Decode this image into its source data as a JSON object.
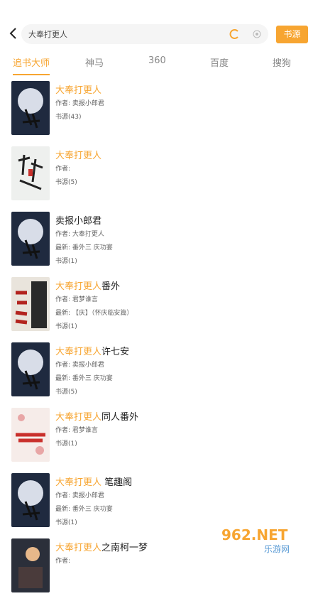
{
  "search": {
    "query": "大奉打更人",
    "button": "书源"
  },
  "tabs": [
    "追书大师",
    "神马",
    "360",
    "百度",
    "搜狗"
  ],
  "books": [
    {
      "hl": "大奉打更人",
      "rest": "",
      "author": "作者: 卖报小郎君",
      "latest": "",
      "sources": "书源(43)"
    },
    {
      "hl": "大奉打更人",
      "rest": "",
      "author": "作者:",
      "latest": "",
      "sources": "书源(5)"
    },
    {
      "hl": "",
      "rest": "卖报小郎君",
      "author": "作者: 大奉打更人",
      "latest": "最新: 番外三 庆功宴",
      "sources": "书源(1)"
    },
    {
      "hl": "大奉打更人",
      "rest": "番外",
      "author": "作者: 君梦谁言",
      "latest": "最新: 【庆】（怀庆临安篇）",
      "sources": "书源(1)"
    },
    {
      "hl": "大奉打更人",
      "rest": "许七安",
      "author": "作者: 卖报小郎君",
      "latest": "最新: 番外三 庆功宴",
      "sources": "书源(5)"
    },
    {
      "hl": "大奉打更人",
      "rest": "同人番外",
      "author": "作者: 君梦谁言",
      "latest": "",
      "sources": "书源(1)"
    },
    {
      "hl": "大奉打更人",
      "rest": " 笔趣阁",
      "author": "作者: 卖报小郎君",
      "latest": "最新: 番外三 庆功宴",
      "sources": "书源(1)"
    },
    {
      "hl": "大奉打更人",
      "rest": "之南柯一梦",
      "author": "作者:",
      "latest": "",
      "sources": ""
    }
  ],
  "covers": {
    "moon": {
      "kind": "moon"
    },
    "sketch": {
      "kind": "sketch"
    },
    "dark": {
      "kind": "dark"
    },
    "pink": {
      "kind": "pink"
    }
  },
  "watermark": {
    "text": "962.NET",
    "sub": "乐游网"
  },
  "colors": {
    "accent": "#f7a531"
  }
}
